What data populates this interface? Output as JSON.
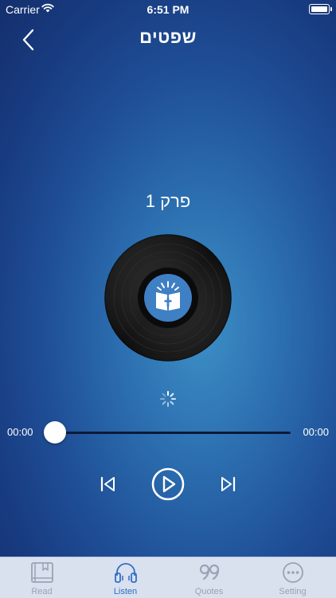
{
  "status_bar": {
    "carrier": "Carrier",
    "time": "6:51 PM"
  },
  "nav": {
    "title": "שפטים"
  },
  "player": {
    "chapter": "פרק 1",
    "elapsed": "00:00",
    "duration": "00:00",
    "progress": 0
  },
  "tabs": [
    {
      "label": "Read",
      "icon": "book-icon",
      "active": false
    },
    {
      "label": "Listen",
      "icon": "headphones-icon",
      "active": true
    },
    {
      "label": "Quotes",
      "icon": "quote-icon",
      "active": false
    },
    {
      "label": "Setting",
      "icon": "more-icon",
      "active": false
    }
  ],
  "colors": {
    "accent": "#2e6fc7",
    "tab_inactive": "#9aa3b5",
    "tabbar_bg": "#d9e0ee",
    "icon_blue": "#3f7fc4"
  }
}
